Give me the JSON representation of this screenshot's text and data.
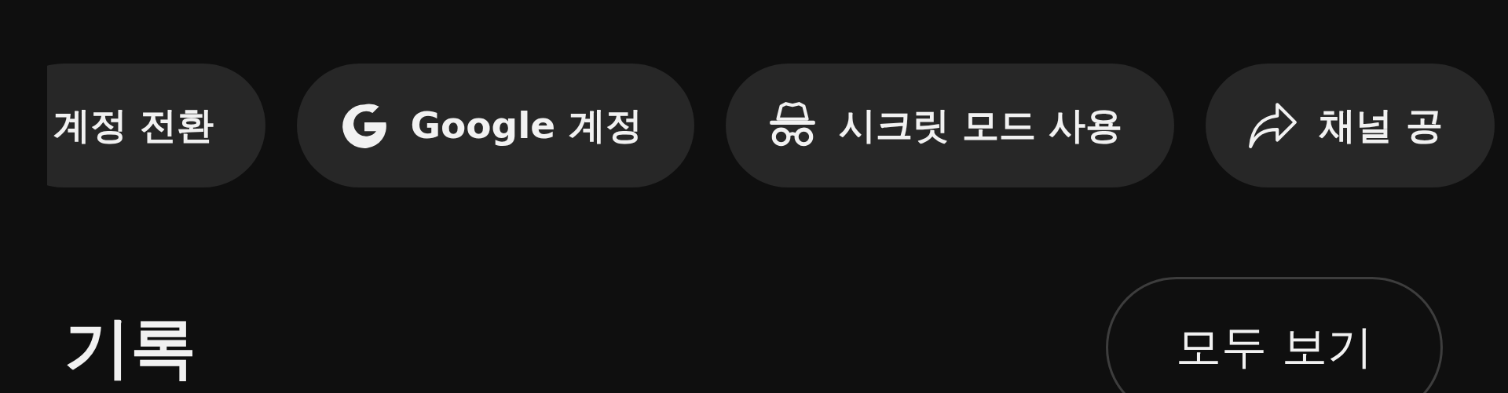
{
  "chips": [
    {
      "label": "계정 전환",
      "kind": "plain"
    },
    {
      "label": "Google 계정",
      "kind": "google"
    },
    {
      "label": "시크릿 모드 사용",
      "kind": "incognito"
    },
    {
      "label": "채널 공",
      "kind": "share"
    }
  ],
  "history": {
    "title": "기록",
    "button": "모두 보기"
  }
}
